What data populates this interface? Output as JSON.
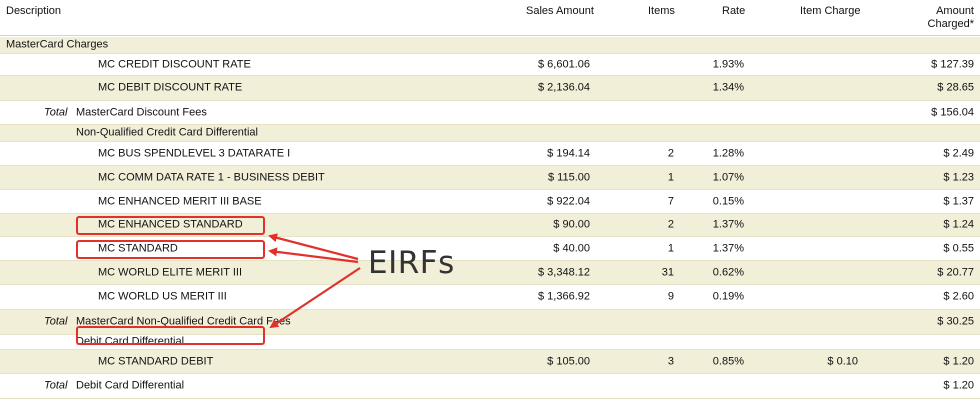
{
  "header": {
    "description": "Description",
    "sales_amount": "Sales Amount",
    "items": "Items",
    "rate": "Rate",
    "item_charge": "Item  Charge",
    "amount_charged": "Amount\nCharged*"
  },
  "rows": [
    {
      "label": "MasterCard Charges",
      "level": 0
    },
    {
      "label": "MC CREDIT DISCOUNT RATE",
      "level": 2,
      "sales": "$ 6,601.06",
      "rate": "1.93%",
      "amount": "$ 127.39"
    },
    {
      "label": "MC DEBIT DISCOUNT RATE",
      "level": 2,
      "sales": "$ 2,136.04",
      "rate": "1.34%",
      "amount": "$ 28.65"
    },
    {
      "total": "Total",
      "label": "MasterCard Discount Fees",
      "amount": "$ 156.04"
    },
    {
      "label": "Non-Qualified Credit Card Differential",
      "level": 1
    },
    {
      "label": "MC BUS SPENDLEVEL 3 DATARATE I",
      "level": 2,
      "sales": "$ 194.14",
      "items": "2",
      "rate": "1.28%",
      "amount": "$ 2.49"
    },
    {
      "label": "MC COMM DATA RATE 1 - BUSINESS DEBIT",
      "level": 2,
      "sales": "$ 115.00",
      "items": "1",
      "rate": "1.07%",
      "amount": "$ 1.23"
    },
    {
      "label": "MC ENHANCED MERIT III BASE",
      "level": 2,
      "sales": "$ 922.04",
      "items": "7",
      "rate": "0.15%",
      "amount": "$ 1.37"
    },
    {
      "label": "MC ENHANCED STANDARD",
      "level": 2,
      "sales": "$ 90.00",
      "items": "2",
      "rate": "1.37%",
      "amount": "$ 1.24"
    },
    {
      "label": "MC STANDARD",
      "level": 2,
      "sales": "$ 40.00",
      "items": "1",
      "rate": "1.37%",
      "amount": "$ 0.55"
    },
    {
      "label": "MC WORLD ELITE MERIT III",
      "level": 2,
      "sales": "$ 3,348.12",
      "items": "31",
      "rate": "0.62%",
      "amount": "$ 20.77"
    },
    {
      "label": "MC WORLD US MERIT III",
      "level": 2,
      "sales": "$ 1,366.92",
      "items": "9",
      "rate": "0.19%",
      "amount": "$ 2.60"
    },
    {
      "total": "Total",
      "label": "MasterCard Non-Qualified Credit Card Fees",
      "amount": "$ 30.25"
    },
    {
      "label": "Debit Card Differential",
      "level": 1
    },
    {
      "label": "MC STANDARD DEBIT",
      "level": 2,
      "sales": "$ 105.00",
      "items": "3",
      "rate": "0.85%",
      "item_charge": "$ 0.10",
      "amount": "$ 1.20"
    },
    {
      "total": "Total",
      "label": "Debit Card Differential",
      "amount": "$ 1.20"
    }
  ],
  "annotation": {
    "label": "EIRFs",
    "color": "#e0322b"
  }
}
